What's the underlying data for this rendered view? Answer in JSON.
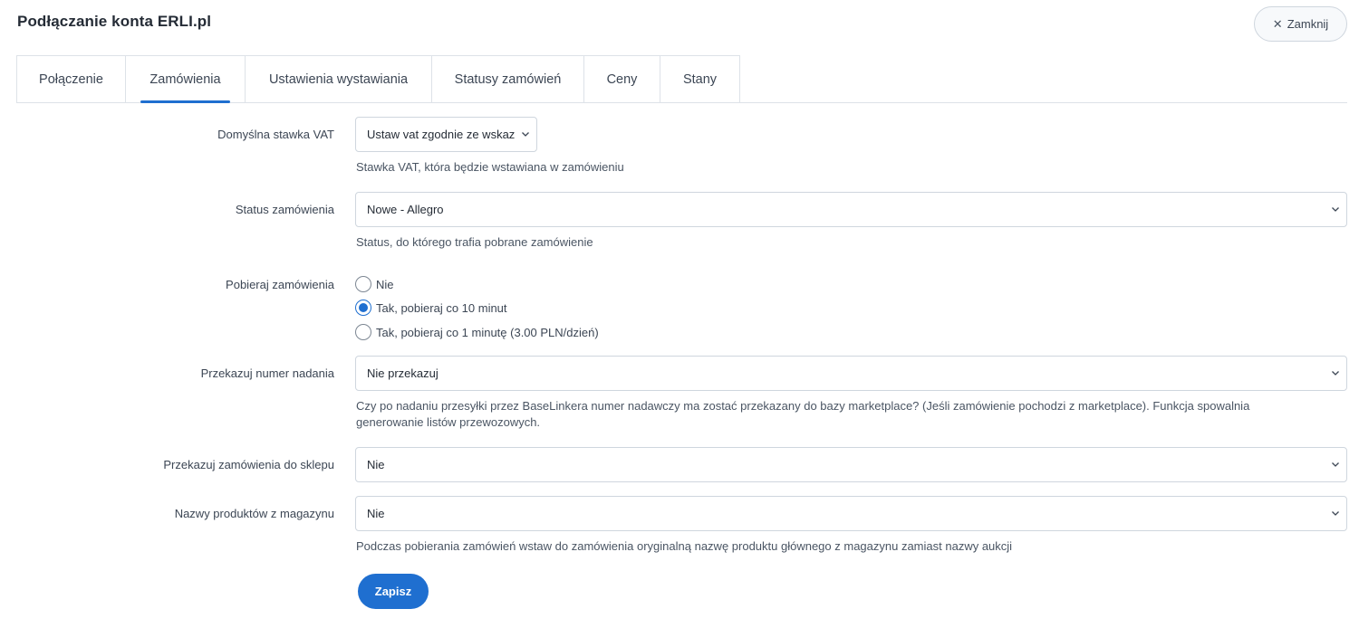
{
  "page": {
    "title": "Podłączanie konta ERLI.pl"
  },
  "header": {
    "close_label": "Zamknij",
    "close_icon": "close-icon"
  },
  "tabs": [
    {
      "label": "Połączenie",
      "active": false
    },
    {
      "label": "Zamówienia",
      "active": true
    },
    {
      "label": "Ustawienia wystawiania",
      "active": false
    },
    {
      "label": "Statusy zamówień",
      "active": false
    },
    {
      "label": "Ceny",
      "active": false
    },
    {
      "label": "Stany",
      "active": false
    }
  ],
  "form": {
    "vat": {
      "label": "Domyślna stawka VAT",
      "value": "Ustaw vat zgodnie ze wskaz",
      "help": "Stawka VAT, która będzie wstawiana w zamówieniu"
    },
    "status": {
      "label": "Status zamówienia",
      "value": "Nowe - Allegro",
      "help": "Status, do którego trafia pobrane zamówienie"
    },
    "fetch": {
      "label": "Pobieraj zamówienia",
      "options": [
        {
          "label": "Nie",
          "checked": false
        },
        {
          "label": "Tak, pobieraj co 10 minut",
          "checked": true
        },
        {
          "label": "Tak, pobieraj co 1 minutę (3.00 PLN/dzień)",
          "checked": false
        }
      ]
    },
    "tracking": {
      "label": "Przekazuj numer nadania",
      "value": "Nie przekazuj",
      "help_line1": "Czy po nadaniu przesyłki przez BaseLinkera numer nadawczy ma zostać przekazany do bazy marketplace? (Jeśli zamówienie pochodzi z marketplace). Funkcja spowalnia",
      "help_line2": "generowanie listów przewozowych."
    },
    "to_shop": {
      "label": "Przekazuj zamówienia do sklepu",
      "value": "Nie"
    },
    "product_names": {
      "label": "Nazwy produktów z magazynu",
      "value": "Nie",
      "help": "Podczas pobierania zamówień wstaw do zamówienia oryginalną nazwę produktu głównego z magazynu zamiast nazwy aukcji"
    },
    "save_label": "Zapisz"
  },
  "colors": {
    "accent": "#1f6fd0",
    "border": "#cfd6de",
    "text": "#3c4654"
  }
}
